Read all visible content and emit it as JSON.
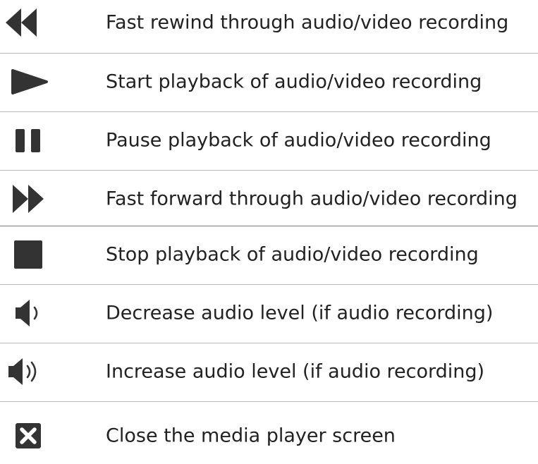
{
  "legend": {
    "rows": [
      {
        "icon": "rewind-icon",
        "label": "Fast rewind through audio/video recording"
      },
      {
        "icon": "play-icon",
        "label": "Start playback of audio/video recording"
      },
      {
        "icon": "pause-icon",
        "label": "Pause playback of audio/video recording"
      },
      {
        "icon": "fast-forward-icon",
        "label": "Fast forward through audio/video recording"
      },
      {
        "icon": "stop-icon",
        "label": "Stop playback of audio/video recording"
      },
      {
        "icon": "volume-down-icon",
        "label": "Decrease audio level (if audio recording)"
      },
      {
        "icon": "volume-up-icon",
        "label": "Increase audio level (if audio recording)"
      },
      {
        "icon": "close-icon",
        "label": "Close the media player screen"
      }
    ]
  },
  "colors": {
    "icon": "#333333",
    "text": "#222222",
    "divider": "#b8b8b8"
  }
}
